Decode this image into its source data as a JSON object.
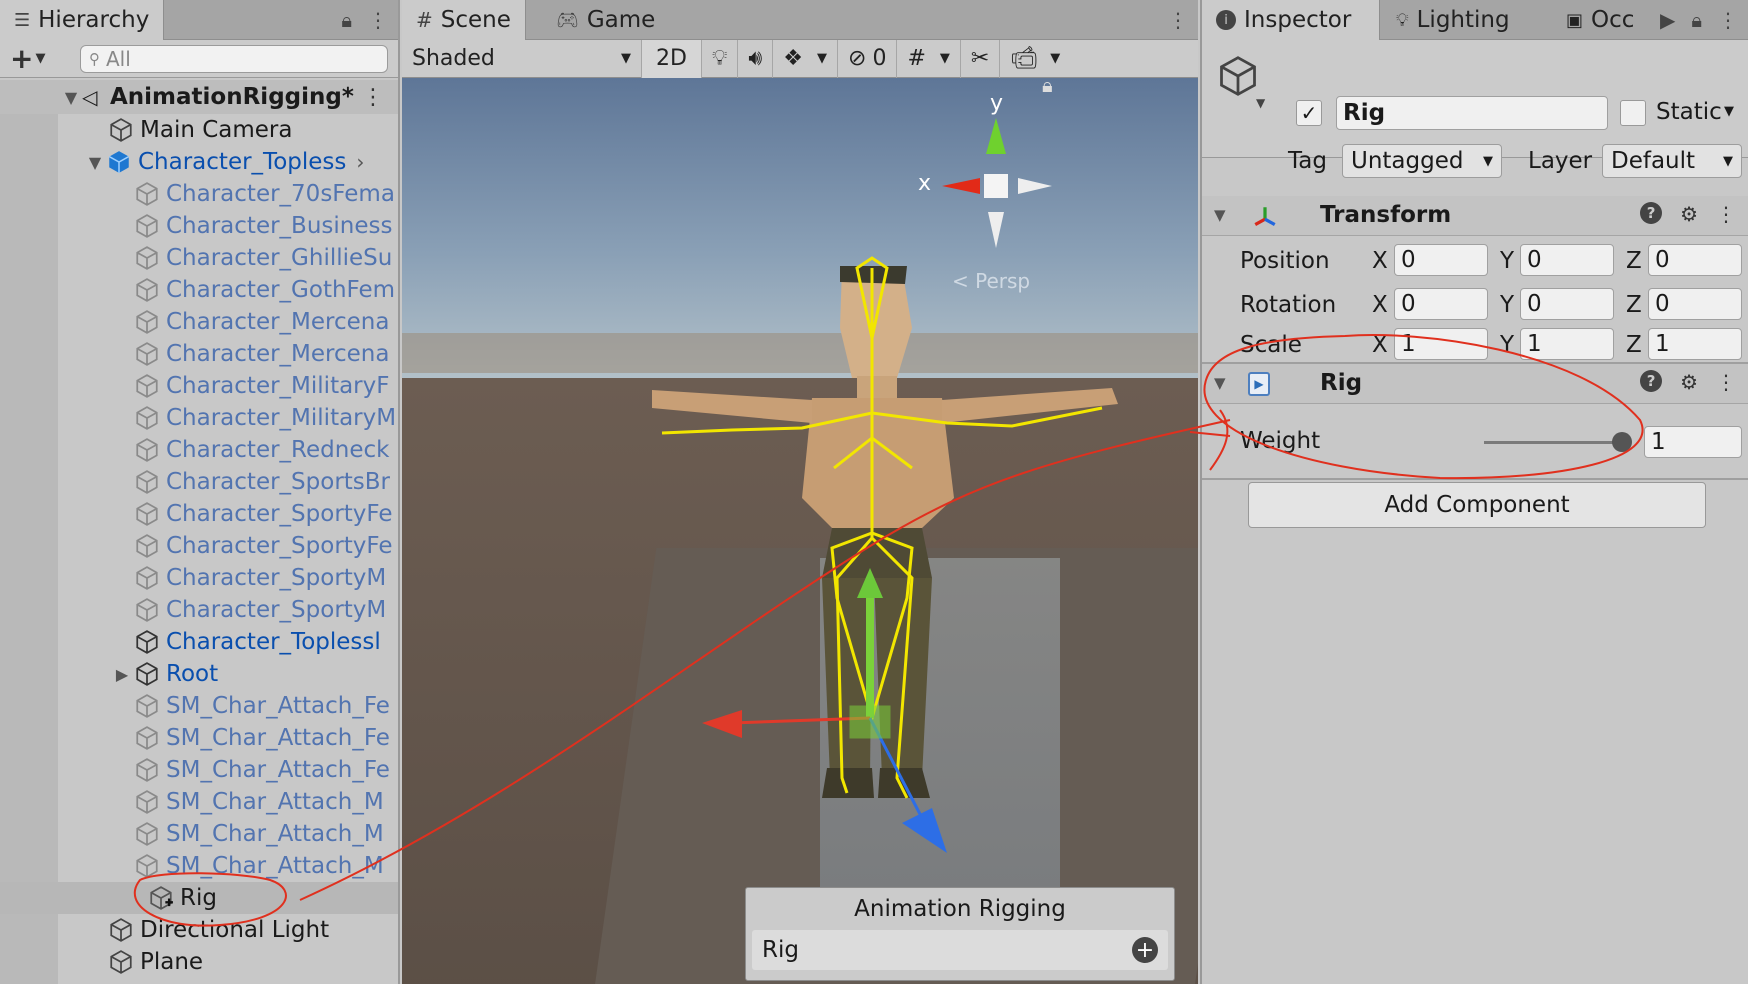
{
  "hierarchy": {
    "tab_label": "Hierarchy",
    "search_placeholder": "All",
    "scene_root": "AnimationRigging*",
    "items": [
      {
        "label": "Main Camera"
      },
      {
        "label": "Character_Topless"
      },
      {
        "label": "Character_70sFema"
      },
      {
        "label": "Character_Business"
      },
      {
        "label": "Character_GhillieSu"
      },
      {
        "label": "Character_GothFem"
      },
      {
        "label": "Character_Mercena"
      },
      {
        "label": "Character_Mercena"
      },
      {
        "label": "Character_MilitaryF"
      },
      {
        "label": "Character_MilitaryM"
      },
      {
        "label": "Character_Redneck"
      },
      {
        "label": "Character_SportsBr"
      },
      {
        "label": "Character_SportyFe"
      },
      {
        "label": "Character_SportyFe"
      },
      {
        "label": "Character_SportyM"
      },
      {
        "label": "Character_SportyM"
      },
      {
        "label": "Character_Toplessl"
      },
      {
        "label": "Root"
      },
      {
        "label": "SM_Char_Attach_Fe"
      },
      {
        "label": "SM_Char_Attach_Fe"
      },
      {
        "label": "SM_Char_Attach_Fe"
      },
      {
        "label": "SM_Char_Attach_M"
      },
      {
        "label": "SM_Char_Attach_M"
      },
      {
        "label": "SM_Char_Attach_M"
      },
      {
        "label": "Rig"
      },
      {
        "label": "Directional Light"
      },
      {
        "label": "Plane"
      }
    ]
  },
  "scene": {
    "tab_scene": "Scene",
    "tab_game": "Game",
    "shading_mode": "Shaded",
    "btn_2d": "2D",
    "hidden_count": "0",
    "gizmo_y": "y",
    "gizmo_x": "x",
    "persp_label": "< Persp",
    "overlay_title": "Animation Rigging",
    "overlay_item": "Rig"
  },
  "inspector": {
    "tab_inspector": "Inspector",
    "tab_lighting": "Lighting",
    "tab_occ": "Occ",
    "object_name": "Rig",
    "static_label": "Static",
    "tag_label": "Tag",
    "tag_value": "Untagged",
    "layer_label": "Layer",
    "layer_value": "Default",
    "transform_title": "Transform",
    "position_label": "Position",
    "rotation_label": "Rotation",
    "scale_label": "Scale",
    "axis_x": "X",
    "axis_y": "Y",
    "axis_z": "Z",
    "position": {
      "x": "0",
      "y": "0",
      "z": "0"
    },
    "rotation": {
      "x": "0",
      "y": "0",
      "z": "0"
    },
    "scale": {
      "x": "1",
      "y": "1",
      "z": "1"
    },
    "rig_title": "Rig",
    "weight_label": "Weight",
    "weight_value": "1",
    "add_component": "Add Component"
  },
  "colors": {
    "accent_blue": "#0a4fae",
    "annotation_red": "#e0301e",
    "bone_yellow": "#f2e600"
  }
}
